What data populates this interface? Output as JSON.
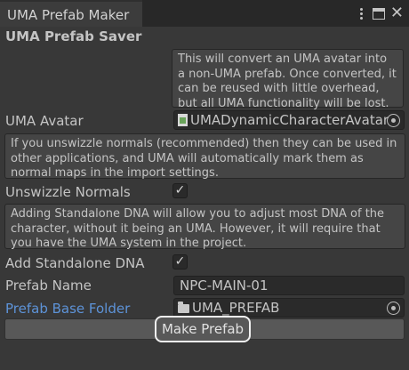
{
  "window": {
    "tab_title": "UMA Prefab Maker",
    "controls": {
      "menu_icon": "kebab-menu-icon",
      "maximize_icon": "maximize-icon",
      "close_icon": "close-icon",
      "close_glyph": "✕"
    }
  },
  "section": {
    "title": "UMA Prefab Saver"
  },
  "help": {
    "intro": "This will convert an UMA avatar into a non-UMA prefab. Once converted, it can be reused with little overhead, but all UMA functionality will be lost.",
    "unswizzle": "If you unswizzle normals (recommended) then they can be used in other applications, and UMA will automatically mark them as normal maps in the import settings.",
    "standalone": "Adding Standalone DNA will allow you to adjust most DNA of the character, without it being an UMA. However, it will require that you have the UMA system in the project."
  },
  "fields": {
    "avatar": {
      "label": "UMA Avatar",
      "value": "UMADynamicCharacterAvatar",
      "icon": "script-object-icon"
    },
    "unswizzle": {
      "label": "Unswizzle Normals",
      "checked": true,
      "check_glyph": "✓"
    },
    "standalone_dna": {
      "label": "Add Standalone DNA",
      "checked": true,
      "check_glyph": "✓"
    },
    "prefab_name": {
      "label": "Prefab Name",
      "value": "NPC-MAIN-01"
    },
    "base_folder": {
      "label": "Prefab Base Folder",
      "value": "UMA_PREFAB",
      "icon": "folder-icon"
    }
  },
  "actions": {
    "make_prefab": "Make Prefab"
  }
}
